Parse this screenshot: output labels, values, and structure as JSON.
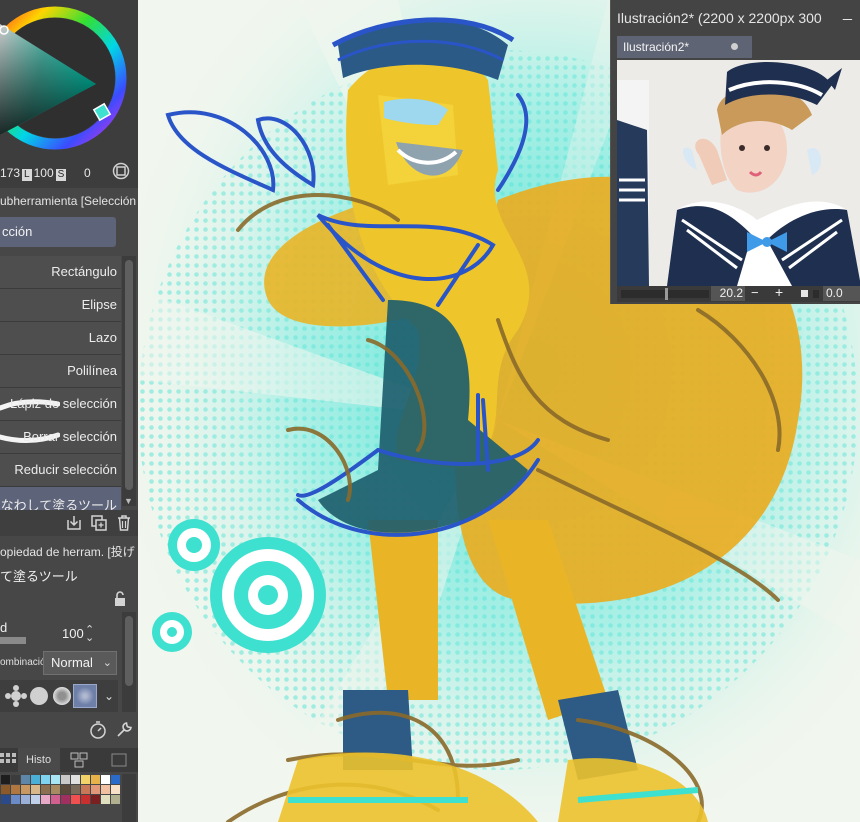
{
  "color_wheel": {
    "hue": "173",
    "sat_label": "L",
    "sat": "100",
    "val_label": "S",
    "val": "0",
    "mode_icon": "wheel-mode-icon"
  },
  "subtool_panel": {
    "header": "ubherramienta [Selección",
    "group": "cción",
    "items": [
      {
        "label": "Rectángulo"
      },
      {
        "label": "Elipse"
      },
      {
        "label": "Lazo"
      },
      {
        "label": "Polilínea"
      },
      {
        "label": "Lápiz de selección"
      },
      {
        "label": "Borrar selección"
      },
      {
        "label": "Reducir selección"
      },
      {
        "label": "ずなわして塗るツール"
      }
    ],
    "actions": [
      "copy-to-folder-icon",
      "duplicate-icon",
      "delete-icon"
    ]
  },
  "tool_property": {
    "header": "opiedad de herram. [投げ",
    "tool_name": "て塗るツール",
    "opacity_label": "d",
    "opacity_value": "100",
    "opacity_fraction": 0.2,
    "blend_label": "ombinació",
    "blend_value": "Normal",
    "icons": [
      "lock-icon",
      "reset-icon",
      "settings-wrench-icon",
      "chevron-down-icon"
    ]
  },
  "bottom_tabs": {
    "history": "Histo"
  },
  "palette_colors": [
    "#1e1e1e",
    "#3c3c3c",
    "#5e86a8",
    "#4ab0d8",
    "#7fd4f0",
    "#a8e6f6",
    "#c8c8c8",
    "#e0e0e0",
    "#f4d26a",
    "#e8b24a",
    "#ffffff",
    "#2a6ac8",
    "#8a5a2a",
    "#b07840",
    "#c89860",
    "#d8b888",
    "#8a7050",
    "#a88a60",
    "#5a4a3a",
    "#7a6a5a",
    "#c87858",
    "#e09878",
    "#f0c0a0",
    "#f8e0c8",
    "#2a4a8a",
    "#6a8ac8",
    "#9ab0d8",
    "#c0d0e8",
    "#e8a8c8",
    "#d06090",
    "#a03060",
    "#f05050",
    "#c83030",
    "#7a2020",
    "#e0e0c0",
    "#b0b090"
  ],
  "navigator": {
    "title": "Ilustración2* (2200 x 2200px 300",
    "minimize": "_",
    "tab": "Ilustración2*",
    "zoom": "20.2",
    "zoom_out": "−",
    "zoom_in": "+",
    "rotation": "0.0"
  },
  "colors": {
    "panel_bg": "#474747",
    "selected_item": "#5d6378",
    "canvas_bg": "#f1f6ee",
    "accent_teal": "#3ee0cf",
    "sketch_gold": "#e8b320",
    "sketch_blue": "#2a55c8"
  }
}
